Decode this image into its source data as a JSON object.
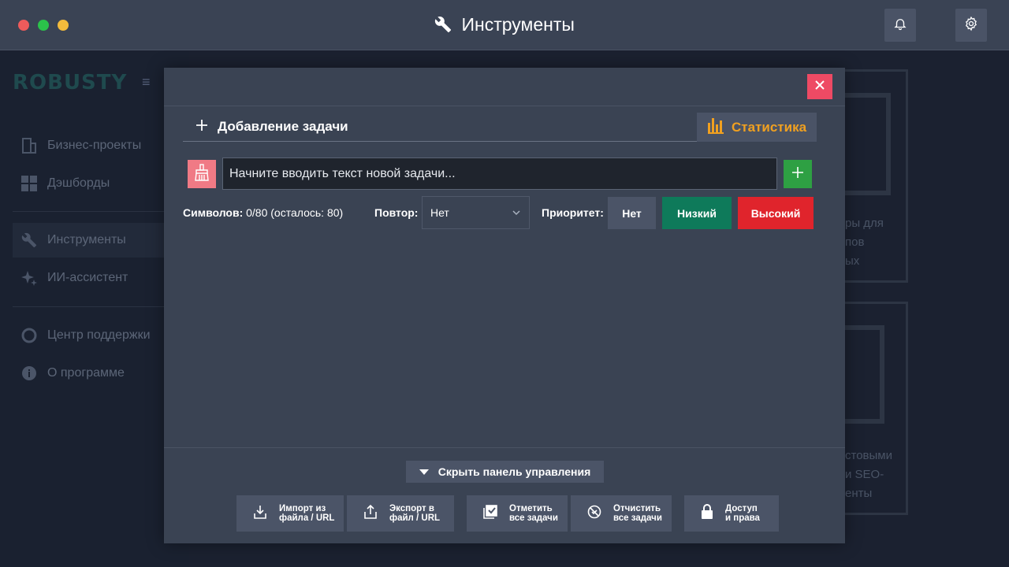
{
  "window": {
    "title": "Инструменты"
  },
  "sidebar": {
    "logo": "ROBUSTY",
    "items": [
      {
        "label": "Бизнес-проекты",
        "icon": "building-icon"
      },
      {
        "label": "Дэшборды",
        "icon": "dashboard-grid-icon"
      },
      {
        "label": "Инструменты",
        "icon": "wrench-icon",
        "active": true
      },
      {
        "label": "ИИ-ассистент",
        "icon": "sparkles-icon"
      },
      {
        "label": "Центр поддержки",
        "icon": "lifebuoy-icon"
      },
      {
        "label": "О программе",
        "icon": "info-icon"
      }
    ]
  },
  "background_cards": {
    "card1_text": [
      "ры для",
      "пов",
      "ых"
    ],
    "card2_text": [
      "стовыми",
      "и SEO-",
      "енты"
    ]
  },
  "modal": {
    "section_title": "Добавление задачи",
    "stats_label": "Статистика",
    "input_placeholder": "Начните вводить текст новой задачи...",
    "chars_label": "Символов:",
    "chars_value": "0/80 (осталось: 80)",
    "repeat_label": "Повтор:",
    "repeat_value": "Нет",
    "priority_label": "Приоритет:",
    "priority_options": [
      "Нет",
      "Низкий",
      "Высокий"
    ],
    "hide_panel_label": "Скрыть панель управления",
    "actions": [
      {
        "label": "Импорт из\nфайла / URL",
        "icon": "import-icon"
      },
      {
        "label": "Экспорт в\nфайл / URL",
        "icon": "export-icon"
      },
      {
        "label": "Отметить\nвсе задачи",
        "icon": "check-all-icon"
      },
      {
        "label": "Отчистить\nвсе задачи",
        "icon": "clear-icon"
      },
      {
        "label": "Доступ\nи права",
        "icon": "lock-icon"
      }
    ]
  },
  "colors": {
    "close": "#ee4a64",
    "stats": "#f0a020",
    "add": "#2ea043",
    "priority_low": "#0e7a5a",
    "priority_high": "#e0242c"
  }
}
